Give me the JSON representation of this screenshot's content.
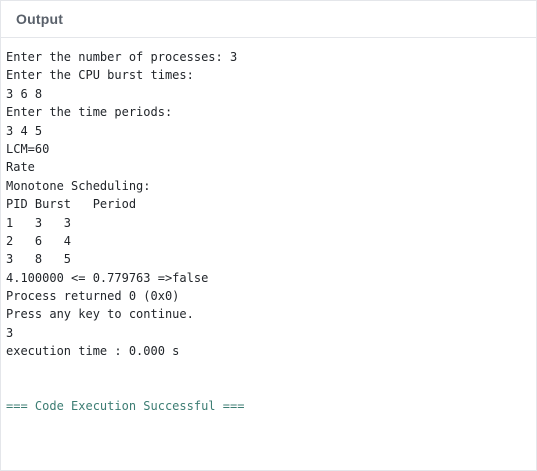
{
  "header": {
    "title": "Output"
  },
  "output": {
    "lines": [
      "Enter the number of processes: 3",
      "Enter the CPU burst times:",
      "3 6 8",
      "Enter the time periods:",
      "3 4 5",
      "LCM=60",
      "Rate",
      "Monotone Scheduling:",
      "PID Burst   Period",
      "1   3   3",
      "2   6   4",
      "3   8   5",
      "4.100000 <= 0.779763 =>false",
      "Process returned 0 (0x0)",
      "Press any key to continue.",
      "3",
      "execution time : 0.000 s",
      "",
      "",
      "=== Code Execution Successful ==="
    ]
  },
  "colors": {
    "success": "#3c7d73",
    "text": "#1f2328",
    "header_text": "#59606a",
    "border": "#e4e6ea"
  }
}
